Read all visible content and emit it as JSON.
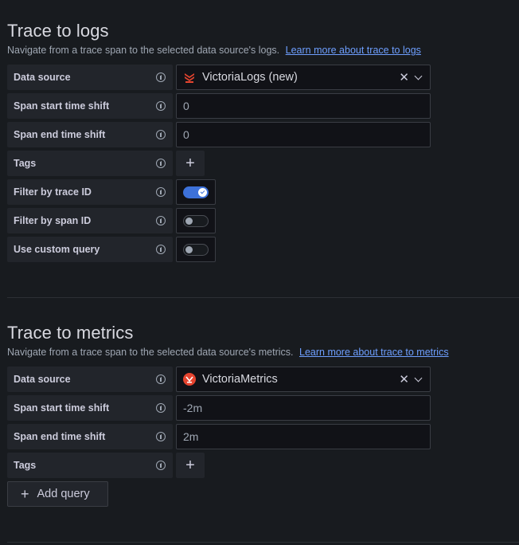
{
  "logs": {
    "title": "Trace to logs",
    "description": "Navigate from a trace span to the selected data source's logs.",
    "learn_more": "Learn more about trace to logs",
    "rows": {
      "data_source": {
        "label": "Data source",
        "value": "VictoriaLogs (new)"
      },
      "span_start": {
        "label": "Span start time shift",
        "placeholder": "0"
      },
      "span_end": {
        "label": "Span end time shift",
        "placeholder": "0"
      },
      "tags": {
        "label": "Tags"
      },
      "filter_trace": {
        "label": "Filter by trace ID",
        "on": true
      },
      "filter_span": {
        "label": "Filter by span ID",
        "on": false
      },
      "custom_query": {
        "label": "Use custom query",
        "on": false
      }
    }
  },
  "metrics": {
    "title": "Trace to metrics",
    "description": "Navigate from a trace span to the selected data source's metrics.",
    "learn_more": "Learn more about trace to metrics",
    "rows": {
      "data_source": {
        "label": "Data source",
        "value": "VictoriaMetrics"
      },
      "span_start": {
        "label": "Span start time shift",
        "value": "-2m"
      },
      "span_end": {
        "label": "Span end time shift",
        "value": "2m"
      },
      "tags": {
        "label": "Tags"
      }
    },
    "add_query_label": "Add query"
  },
  "icons": {
    "clear": "close-icon",
    "dropdown": "chevron-down-icon",
    "info": "info-circle-icon",
    "add": "plus-icon"
  },
  "colors": {
    "background": "#181b1f",
    "label_bg": "#22252b",
    "input_bg": "#111217",
    "link": "#6e9fff",
    "toggle_on": "#3d71d9",
    "victorialogs_brand": "#e5442f",
    "victoriametrics_brand": "#e5442f"
  }
}
